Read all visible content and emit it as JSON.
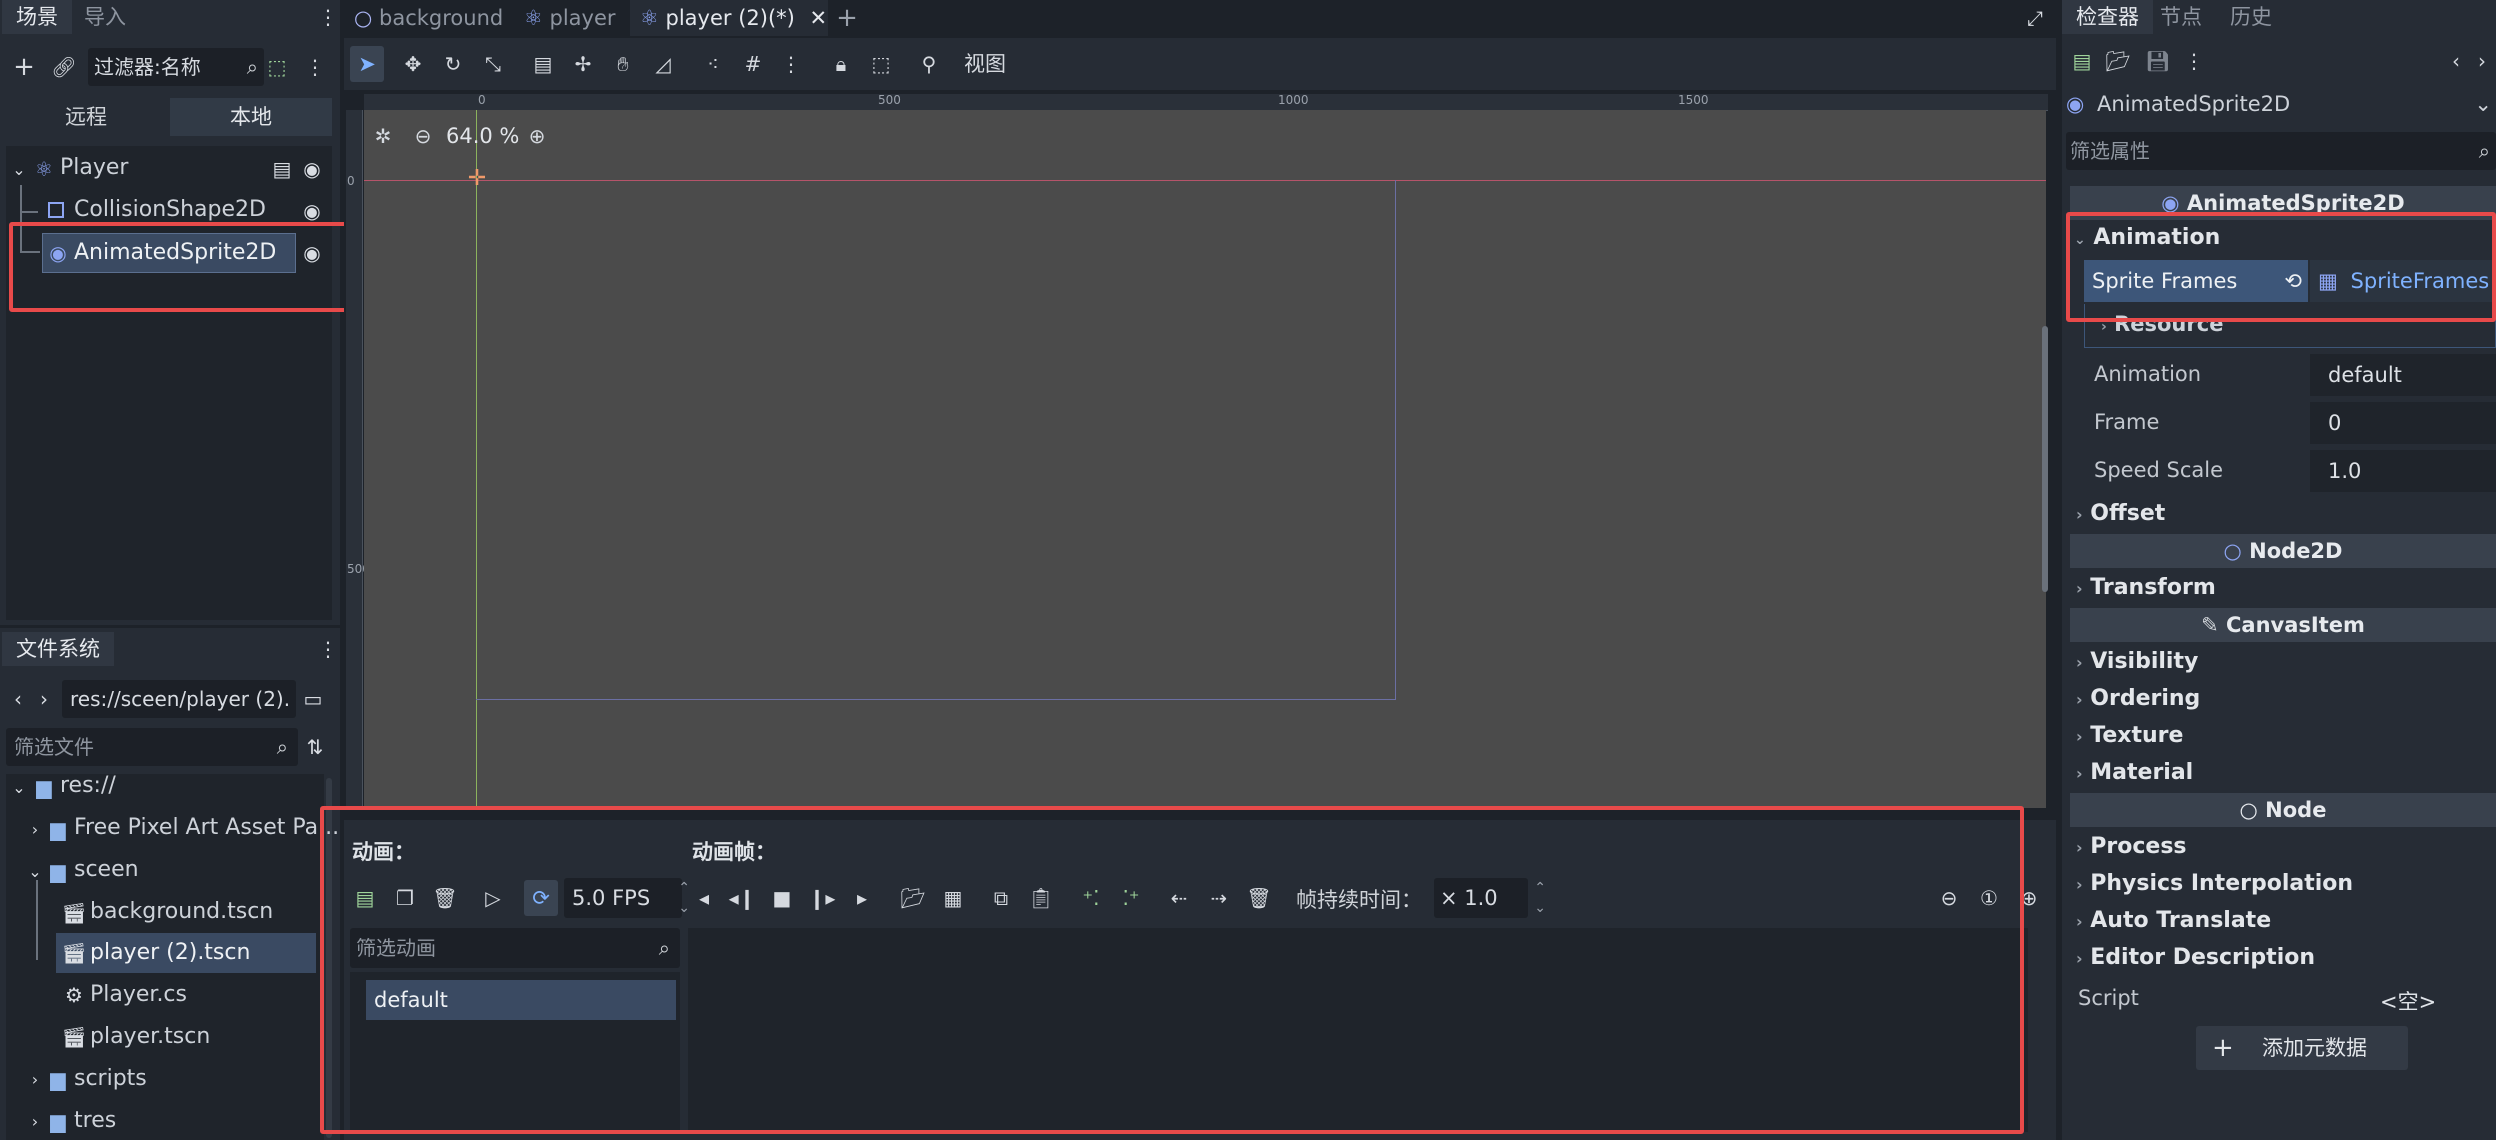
{
  "scene_dock": {
    "tabs": [
      "场景",
      "导入"
    ],
    "filter_label": "过滤器:名称",
    "remote_tab": "远程",
    "local_tab": "本地",
    "tree": [
      {
        "name": "Player"
      },
      {
        "name": "CollisionShape2D"
      },
      {
        "name": "AnimatedSprite2D"
      }
    ]
  },
  "filesystem": {
    "tab": "文件系统",
    "path": "res://sceen/player (2).",
    "filter_placeholder": "筛选文件",
    "items": [
      {
        "name": "res://"
      },
      {
        "name": "Free Pixel Art Asset Pa..."
      },
      {
        "name": "sceen"
      },
      {
        "name": "background.tscn"
      },
      {
        "name": "player (2).tscn"
      },
      {
        "name": "Player.cs"
      },
      {
        "name": "player.tscn"
      },
      {
        "name": "scripts"
      },
      {
        "name": "tres"
      }
    ]
  },
  "editor_tabs": [
    "background",
    "player",
    "player (2)(*)"
  ],
  "toolbar": {
    "view_label": "视图"
  },
  "viewport": {
    "zoom": "64.0 %",
    "ruler_top": [
      "0",
      "500",
      "1000",
      "1500"
    ],
    "ruler_left": [
      "0",
      "500"
    ]
  },
  "sprite_frames_panel": {
    "anim_label": "动画：",
    "frames_label": "动画帧：",
    "fps": "5.0 FPS",
    "duration_label": "帧持续时间：",
    "duration_value": "× 1.0",
    "filter_placeholder": "筛选动画",
    "animations": [
      "default"
    ]
  },
  "inspector": {
    "tabs": [
      "检查器",
      "节点",
      "历史"
    ],
    "node_name": "AnimatedSprite2D",
    "filter_placeholder": "筛选属性",
    "class_header": "AnimatedSprite2D",
    "animation_section": "Animation",
    "sprite_frames_label": "Sprite Frames",
    "sprite_frames_value": "SpriteFrames",
    "resource_label": "Resource",
    "props": [
      {
        "label": "Animation",
        "value": "default"
      },
      {
        "label": "Frame",
        "value": "0"
      },
      {
        "label": "Speed Scale",
        "value": "1.0"
      }
    ],
    "offset_section": "Offset",
    "node2d_header": "Node2D",
    "transform_section": "Transform",
    "canvasitem_header": "CanvasItem",
    "canvas_sections": [
      "Visibility",
      "Ordering",
      "Texture",
      "Material"
    ],
    "node_header": "Node",
    "node_sections": [
      "Process",
      "Physics Interpolation",
      "Auto Translate",
      "Editor Description"
    ],
    "script_label": "Script",
    "script_value": "<空>",
    "add_metadata": "添加元数据"
  }
}
